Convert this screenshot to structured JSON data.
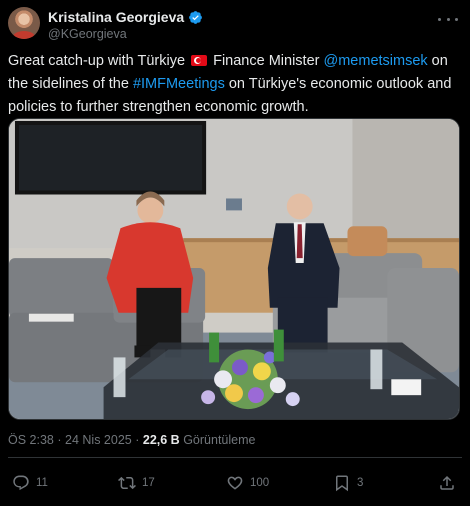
{
  "author": {
    "name": "Kristalina Georgieva",
    "handle": "@KGeorgieva",
    "verified_color": "#1d9bf0"
  },
  "tweet": {
    "text_1": "Great catch-up with Türkiye",
    "flag": "turkey-flag",
    "text_2": " Finance Minister ",
    "mention": "@memetsimsek",
    "text_3": " on the sidelines of the ",
    "hashtag": "#IMFMeetings",
    "text_4": " on Türkiye's economic outlook and policies to further strengthen economic growth."
  },
  "meta": {
    "time": "ÖS 2:38",
    "separator": "·",
    "date": "24 Nis 2025",
    "views": "22,6 B",
    "views_label": "Görüntüleme"
  },
  "actions": {
    "replies": "11",
    "reposts": "17",
    "likes": "100",
    "bookmarks": "3"
  },
  "colors": {
    "background": "#000000",
    "text": "#e7e9ea",
    "secondary": "#71767b",
    "link": "#1d9bf0",
    "border": "#2f3336"
  }
}
